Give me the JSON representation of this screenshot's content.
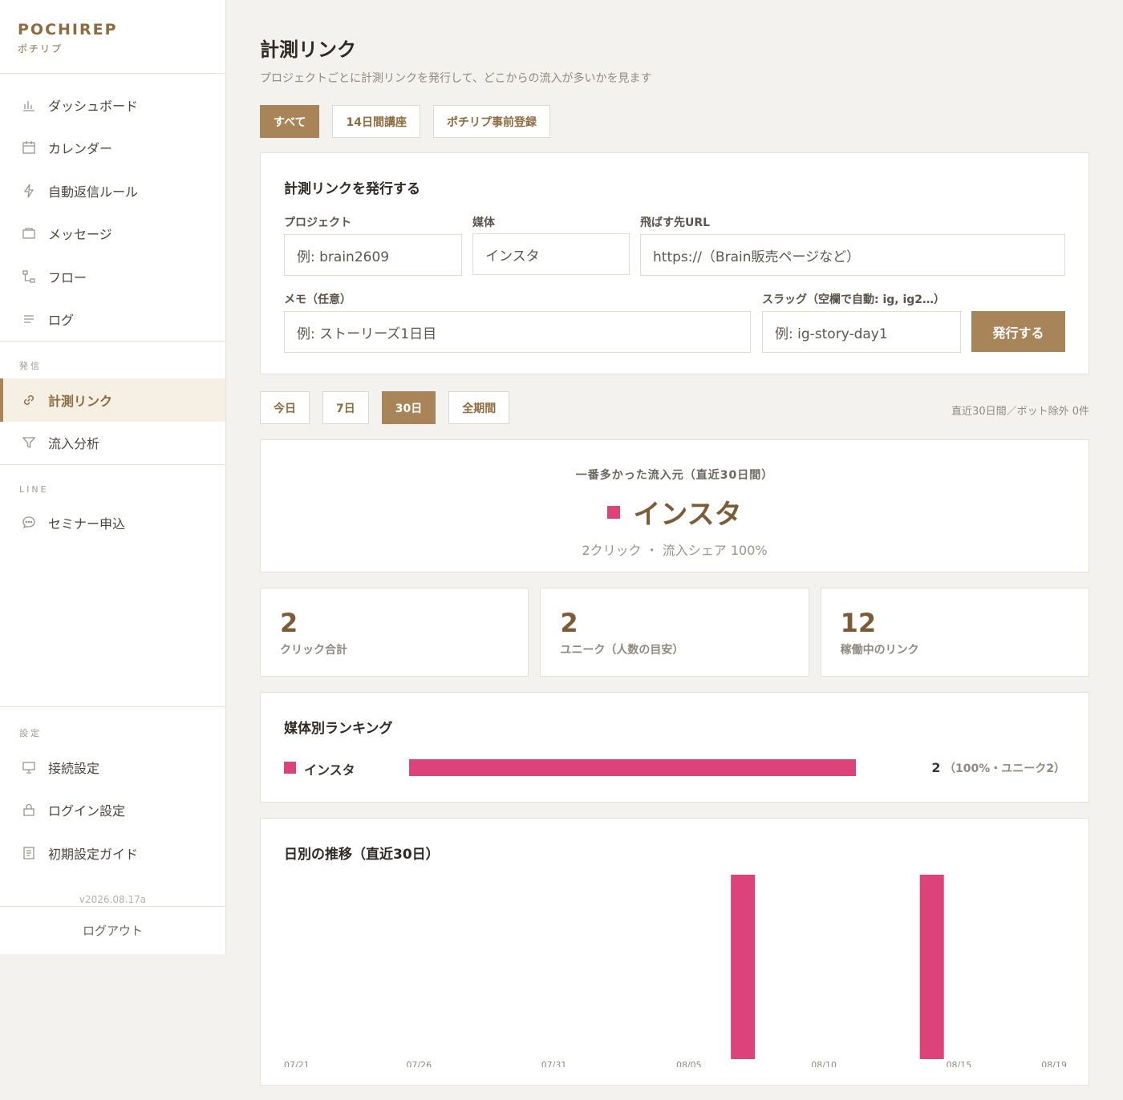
{
  "brand": {
    "name": "POCHIREP",
    "sub": "ポチリプ"
  },
  "sidebar": {
    "items": [
      {
        "label": "ダッシュボード",
        "icon": "bar-chart-icon"
      },
      {
        "label": "カレンダー",
        "icon": "calendar-icon"
      },
      {
        "label": "自動返信ルール",
        "icon": "bolt-icon"
      },
      {
        "label": "メッセージ",
        "icon": "message-box-icon"
      },
      {
        "label": "フロー",
        "icon": "flow-icon"
      },
      {
        "label": "ログ",
        "icon": "list-icon"
      }
    ],
    "section_send": "発信",
    "send_items": [
      {
        "label": "計測リンク",
        "icon": "link-icon",
        "active": true
      },
      {
        "label": "流入分析",
        "icon": "filter-icon"
      }
    ],
    "section_line": "LINE",
    "line_items": [
      {
        "label": "セミナー申込",
        "icon": "chat-icon"
      }
    ],
    "section_settings": "設定",
    "settings_items": [
      {
        "label": "接続設定",
        "icon": "monitor-icon"
      },
      {
        "label": "ログイン設定",
        "icon": "lock-icon"
      },
      {
        "label": "初期設定ガイド",
        "icon": "guide-icon"
      }
    ],
    "version": "v2026.08.17a",
    "logout": "ログアウト"
  },
  "page": {
    "title": "計測リンク",
    "description": "プロジェクトごとに計測リンクを発行して、どこからの流入が多いかを見ます"
  },
  "project_tabs": [
    {
      "label": "すべて",
      "active": true
    },
    {
      "label": "14日間講座",
      "active": false
    },
    {
      "label": "ポチリプ事前登録",
      "active": false
    }
  ],
  "issue_form": {
    "title": "計測リンクを発行する",
    "project_label": "プロジェクト",
    "project_placeholder": "例: brain2609",
    "media_label": "媒体",
    "media_value": "インスタ",
    "url_label": "飛ばす先URL",
    "url_placeholder": "https://（Brain販売ページなど）",
    "memo_label": "メモ（任意）",
    "memo_placeholder": "例: ストーリーズ1日目",
    "slug_label": "スラッグ（空欄で自動: ig, ig2…）",
    "slug_placeholder": "例: ig-story-day1",
    "submit": "発行する"
  },
  "range_tabs": [
    {
      "label": "今日",
      "active": false
    },
    {
      "label": "7日",
      "active": false
    },
    {
      "label": "30日",
      "active": true
    },
    {
      "label": "全期間",
      "active": false
    }
  ],
  "range_note": "直近30日間／ボット除外 0件",
  "top_source": {
    "label": "一番多かった流入元（直近30日間）",
    "name": "インスタ",
    "meta": "2クリック ・ 流入シェア 100%",
    "color": "#dc4479"
  },
  "stats": [
    {
      "value": "2",
      "label": "クリック合計"
    },
    {
      "value": "2",
      "label": "ユニーク（人数の目安）"
    },
    {
      "value": "12",
      "label": "稼働中のリンク"
    }
  ],
  "ranking": {
    "title": "媒体別ランキング",
    "rows": [
      {
        "name": "インスタ",
        "count": "2",
        "detail": "（100%・ユニーク2）",
        "share": 1.0,
        "color": "#dc4479"
      }
    ]
  },
  "chart_data": {
    "type": "bar",
    "title": "日別の推移（直近30日）",
    "x_tick_labels": [
      "07/21",
      "07/26",
      "07/31",
      "08/05",
      "08/10",
      "08/15",
      "08/19"
    ],
    "x_range": [
      "07/21",
      "08/19"
    ],
    "points": [
      {
        "x": "08/07",
        "y": 1
      },
      {
        "x": "08/14",
        "y": 1
      }
    ],
    "ylim": [
      0,
      1
    ],
    "series_color": "#dc4479",
    "grid": false
  }
}
